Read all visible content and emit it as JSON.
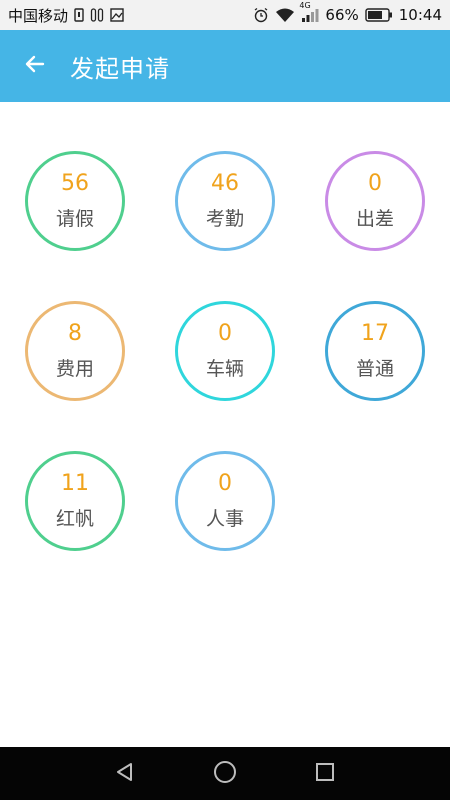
{
  "status_bar": {
    "carrier": "中国移动",
    "network_type": "4G",
    "battery_percent": "66%",
    "time": "10:44",
    "icons": [
      "sim-icon",
      "voicemail-icon",
      "image-icon",
      "alarm-icon",
      "wifi-icon",
      "signal-icon",
      "battery-icon"
    ]
  },
  "header": {
    "title": "发起申请",
    "back_icon": "arrow-left-icon"
  },
  "categories": [
    {
      "count": "56",
      "label": "请假",
      "color": "#4fcf8e"
    },
    {
      "count": "46",
      "label": "考勤",
      "color": "#6fbbea"
    },
    {
      "count": "0",
      "label": "出差",
      "color": "#c98be6"
    },
    {
      "count": "8",
      "label": "费用",
      "color": "#ecb873"
    },
    {
      "count": "0",
      "label": "车辆",
      "color": "#2fd6dc"
    },
    {
      "count": "17",
      "label": "普通",
      "color": "#3fa8d8"
    },
    {
      "count": "11",
      "label": "红帆",
      "color": "#4fcf8e"
    },
    {
      "count": "0",
      "label": "人事",
      "color": "#6fbbea"
    }
  ],
  "colors": {
    "app_bar": "#45b5e6",
    "count_text": "#f0a31c",
    "label_text": "#555555"
  },
  "nav_bar": {
    "icons": [
      "back-triangle-icon",
      "home-circle-icon",
      "recents-square-icon"
    ]
  }
}
